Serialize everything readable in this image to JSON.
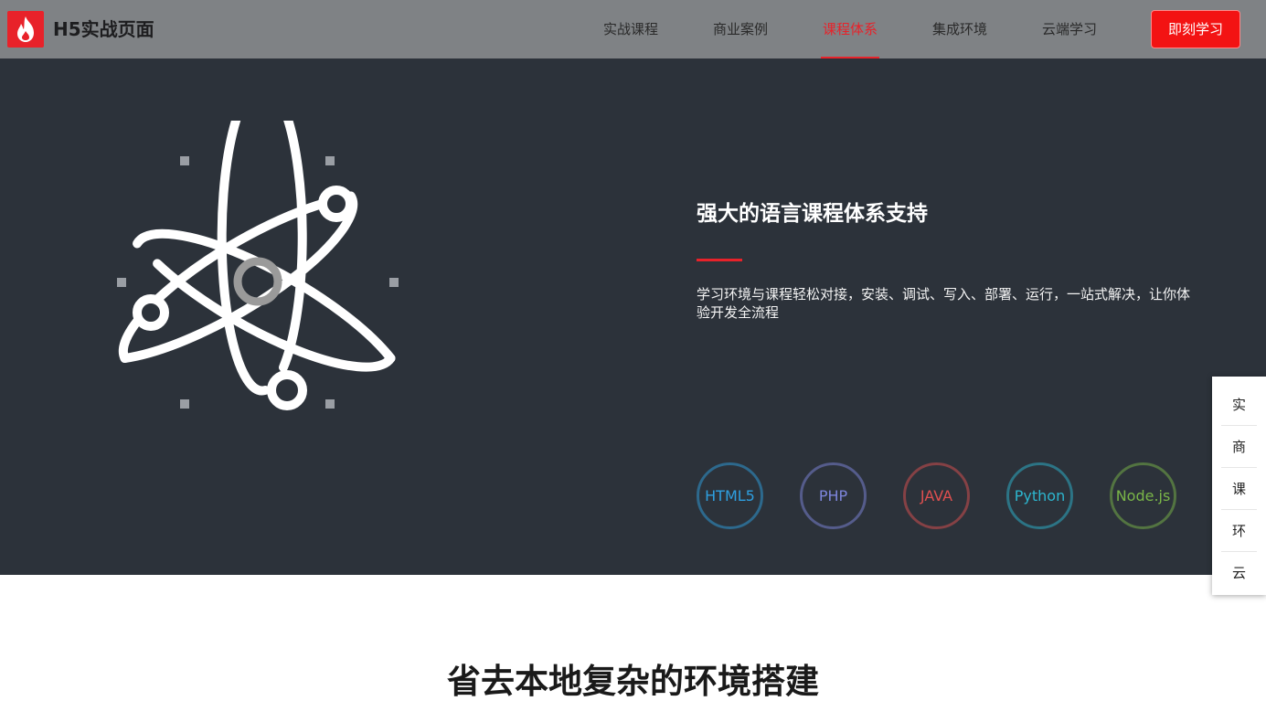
{
  "header": {
    "brand": "H5实战页面",
    "logo_icon": "flame-icon",
    "nav": [
      {
        "label": "实战课程",
        "active": false
      },
      {
        "label": "商业案例",
        "active": false
      },
      {
        "label": "课程体系",
        "active": true
      },
      {
        "label": "集成环境",
        "active": false
      },
      {
        "label": "云端学习",
        "active": false
      }
    ],
    "cta_label": "即刻学习"
  },
  "hero": {
    "illustration_icon": "atom-icon",
    "title": "强大的语言课程体系支持",
    "description": "学习环境与课程轻松对接，安装、调试、写入、部署、运行，一站式解决，让你体验开发全流程",
    "languages": [
      {
        "label": "HTML5",
        "color": "#2e9fe0"
      },
      {
        "label": "PHP",
        "color": "#7d85dc"
      },
      {
        "label": "JAVA",
        "color": "#de4f4f"
      },
      {
        "label": "Python",
        "color": "#2cb6cf"
      },
      {
        "label": "Node.js",
        "color": "#7ab648"
      }
    ]
  },
  "side_nav": {
    "items": [
      "实",
      "商",
      "课",
      "环",
      "云"
    ]
  },
  "section": {
    "title": "省去本地复杂的环境搭建"
  },
  "colors": {
    "header_bg": "#7f8285",
    "hero_bg": "#2c323a",
    "accent": "#e8222a"
  }
}
